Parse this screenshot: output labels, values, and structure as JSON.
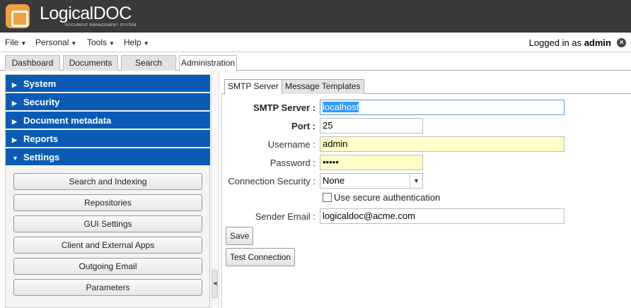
{
  "app": {
    "logo_name": "LogicalDOC",
    "logo_tagline": "DOCUMENT MANAGEMENT SYSTEM",
    "brand_color": "#f0a040"
  },
  "menubar": {
    "items": [
      "File",
      "Personal",
      "Tools",
      "Help"
    ],
    "login_prefix": "Logged in as",
    "login_user": "admin",
    "logout_icon": "×"
  },
  "main_tabs": [
    "Dashboard",
    "Documents",
    "Search",
    "Administration"
  ],
  "left_panel": {
    "sections": [
      "System",
      "Security",
      "Document metadata",
      "Reports",
      "Settings"
    ],
    "settings_buttons": [
      "Search and Indexing",
      "Repositories",
      "GUI Settings",
      "Client and External Apps",
      "Outgoing Email",
      "Parameters"
    ],
    "section_color": "#0a5bb5"
  },
  "sub_tabs": [
    "SMTP Server",
    "Message Templates"
  ],
  "form": {
    "smtp_server_label": "SMTP Server :",
    "smtp_server_value": "localhost",
    "port_label": "Port :",
    "port_value": "25",
    "username_label": "Username :",
    "username_value": "admin",
    "password_label": "Password :",
    "password_value": "•••••",
    "connection_security_label": "Connection Security :",
    "connection_security_value": "None",
    "secure_auth_label": "Use secure authentication",
    "sender_email_label": "Sender Email :",
    "sender_email_value": "logicaldoc@acme.com",
    "save_label": "Save",
    "test_connection_label": "Test Connection"
  }
}
